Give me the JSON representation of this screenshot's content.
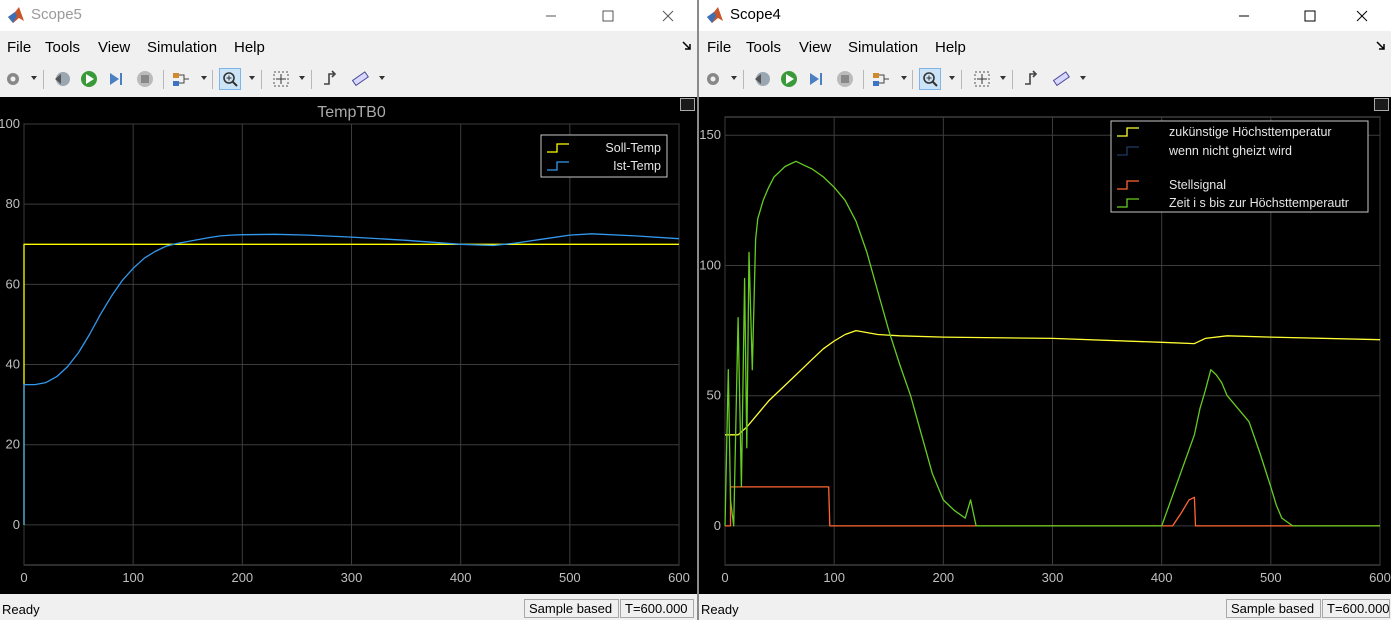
{
  "windows": [
    {
      "title": "Scope5",
      "menu": [
        "File",
        "Tools",
        "View",
        "Simulation",
        "Help"
      ],
      "status": {
        "ready": "Ready",
        "mode": "Sample based",
        "time": "T=600.000"
      },
      "chart_data": {
        "type": "line",
        "title": "TempTB0",
        "xlim": [
          0,
          600
        ],
        "ylim": [
          -10,
          100
        ],
        "xticks": [
          "0",
          "100",
          "200",
          "300",
          "400",
          "500",
          "600"
        ],
        "yticks": [
          "0",
          "20",
          "40",
          "60",
          "80",
          "100"
        ],
        "ytick_values": [
          0,
          20,
          40,
          60,
          80,
          100
        ],
        "grid": true,
        "legend_position": "top-right",
        "legend": [
          "Soll-Temp",
          "Ist-Temp"
        ],
        "series": [
          {
            "name": "Soll-Temp",
            "color": "#ffff00",
            "x": [
              0,
              0,
              600
            ],
            "y": [
              0,
              70,
              70
            ]
          },
          {
            "name": "Ist-Temp",
            "color": "#3399ee",
            "x": [
              0,
              0,
              10,
              20,
              30,
              40,
              50,
              60,
              70,
              80,
              90,
              100,
              110,
              120,
              130,
              140,
              150,
              160,
              170,
              180,
              190,
              200,
              230,
              260,
              300,
              350,
              400,
              420,
              430,
              450,
              480,
              500,
              520,
              560,
              600
            ],
            "y": [
              0,
              35,
              35,
              35.5,
              37,
              39.5,
              43,
              47.5,
              52.5,
              57,
              61,
              64,
              66.5,
              68.2,
              69.5,
              70.2,
              70.7,
              71.2,
              71.7,
              72.1,
              72.3,
              72.4,
              72.5,
              72.3,
              71.8,
              71,
              70,
              69.8,
              69.7,
              70.3,
              71.5,
              72.3,
              72.6,
              72.1,
              71.4
            ]
          }
        ]
      }
    },
    {
      "title": "Scope4",
      "menu": [
        "File",
        "Tools",
        "View",
        "Simulation",
        "Help"
      ],
      "status": {
        "ready": "Ready",
        "mode": "Sample based",
        "time": "T=600.000"
      },
      "chart_data": {
        "type": "line",
        "title": "",
        "xlim": [
          0,
          600
        ],
        "ylim": [
          -15,
          157
        ],
        "xticks": [
          "0",
          "100",
          "200",
          "300",
          "400",
          "500",
          "600"
        ],
        "yticks": [
          "0",
          "50",
          "100",
          "150"
        ],
        "ytick_values": [
          0,
          50,
          100,
          150
        ],
        "grid": true,
        "legend_position": "top-right",
        "legend": [
          "zukünstige Höchsttemperatur",
          "wenn nicht gheizt wird",
          "Stellsignal",
          "Zeit i s bis zur Höchsttemperautr"
        ],
        "series": [
          {
            "name": "zukünstige Höchsttemperatur wenn nicht gheizt wird",
            "color": "#ffff33",
            "x": [
              0,
              12,
              20,
              30,
              40,
              50,
              60,
              70,
              80,
              90,
              100,
              110,
              120,
              140,
              160,
              200,
              300,
              400,
              430,
              440,
              460,
              500,
              600
            ],
            "y": [
              35,
              35,
              38,
              43,
              48,
              52,
              56,
              60,
              64,
              68,
              71,
              73.5,
              75,
              73.5,
              73,
              72.5,
              72,
              70.5,
              70,
              72,
              73,
              72.5,
              71.5
            ]
          },
          {
            "name": "Stellsignal",
            "color": "#ff6633",
            "x": [
              0,
              5,
              5,
              95,
              96,
              410,
              418,
              425,
              430,
              431,
              432,
              600
            ],
            "y": [
              0,
              0,
              15,
              15,
              0,
              0,
              5,
              10,
              11,
              0,
              0,
              0
            ]
          },
          {
            "name": "Zeit i s bis zur Höchsttemperautr",
            "color": "#66cc22",
            "x": [
              0,
              3,
              5,
              8,
              12,
              15,
              18,
              20,
              22,
              25,
              28,
              30,
              35,
              40,
              45,
              50,
              55,
              60,
              65,
              70,
              80,
              90,
              100,
              110,
              120,
              130,
              140,
              150,
              160,
              170,
              180,
              190,
              200,
              210,
              220,
              225,
              230,
              240,
              250,
              300,
              350,
              400,
              430,
              435,
              440,
              445,
              450,
              455,
              460,
              470,
              480,
              490,
              500,
              505,
              510,
              520,
              530,
              540,
              550,
              560,
              580,
              600
            ],
            "y": [
              0,
              60,
              10,
              0,
              80,
              15,
              95,
              30,
              105,
              60,
              110,
              118,
              125,
              130,
              134,
              136,
              138,
              139,
              140,
              139,
              137,
              134,
              130,
              125,
              117,
              105,
              90,
              75,
              62,
              50,
              35,
              20,
              10,
              6,
              3,
              10,
              0,
              0,
              0,
              0,
              0,
              0,
              35,
              45,
              52,
              60,
              58,
              55,
              50,
              45,
              40,
              28,
              15,
              8,
              3,
              0,
              0,
              0,
              0,
              0,
              0,
              0
            ]
          }
        ]
      }
    }
  ]
}
